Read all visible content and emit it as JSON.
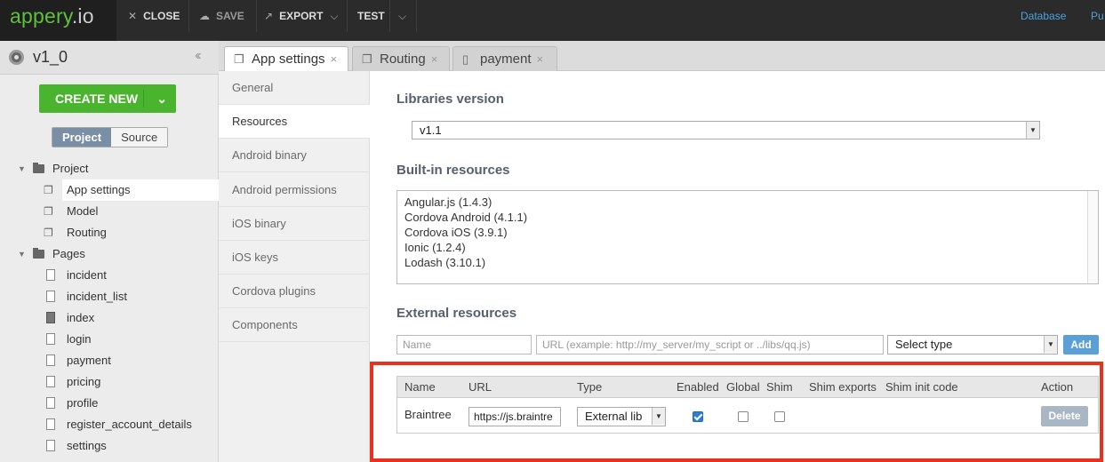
{
  "topbar": {
    "logo_main": "appery",
    "logo_ext": ".io",
    "close_label": "CLOSE",
    "save_label": "SAVE",
    "export_label": "EXPORT",
    "test_label": "TEST",
    "link_database": "Database",
    "link_truncated": "Pu"
  },
  "sidebar": {
    "project_name": "v1_0",
    "create_new_label": "CREATE NEW",
    "toggle": [
      "Project",
      "Source"
    ],
    "tree": [
      {
        "label": "Project",
        "kind": "folder"
      },
      {
        "label": "App settings",
        "kind": "config",
        "selected": true
      },
      {
        "label": "Model",
        "kind": "config"
      },
      {
        "label": "Routing",
        "kind": "config"
      },
      {
        "label": "Pages",
        "kind": "folder"
      },
      {
        "label": "incident",
        "kind": "page"
      },
      {
        "label": "incident_list",
        "kind": "page"
      },
      {
        "label": "index",
        "kind": "page-filled"
      },
      {
        "label": "login",
        "kind": "page"
      },
      {
        "label": "payment",
        "kind": "page"
      },
      {
        "label": "pricing",
        "kind": "page"
      },
      {
        "label": "profile",
        "kind": "page"
      },
      {
        "label": "register_account_details",
        "kind": "page"
      },
      {
        "label": "settings",
        "kind": "page"
      }
    ]
  },
  "tabs": [
    {
      "label": "App settings",
      "close": "×",
      "active": true
    },
    {
      "label": "Routing",
      "close": "×",
      "active": false
    },
    {
      "label": "payment",
      "close": "×",
      "active": false
    }
  ],
  "subnav": [
    "General",
    "Resources",
    "Android binary",
    "Android permissions",
    "iOS binary",
    "iOS keys",
    "Cordova plugins",
    "Components"
  ],
  "libraries": {
    "heading": "Libraries version",
    "selected": "v1.1"
  },
  "builtin": {
    "heading": "Built-in resources",
    "items": [
      "Angular.js (1.4.3)",
      "Cordova Android (4.1.1)",
      "Cordova iOS (3.9.1)",
      "Ionic (1.2.4)",
      "Lodash (3.10.1)"
    ]
  },
  "external": {
    "heading": "External resources",
    "name_placeholder": "Name",
    "url_placeholder": "URL (example: http://my_server/my_script or ../libs/qq.js)",
    "type_selected": "Select type",
    "add_label": "Add",
    "columns": [
      "Name",
      "URL",
      "Type",
      "Enabled",
      "Global",
      "Shim",
      "Shim exports",
      "Shim init code",
      "Action"
    ],
    "rows": [
      {
        "name": "Braintree",
        "url": "https://js.braintre",
        "type": "External lib",
        "enabled": true,
        "global": false,
        "shim": false,
        "action": "Delete"
      }
    ]
  },
  "colors": {
    "accent_green": "#4ab42e",
    "link_blue": "#4aa3df",
    "highlight_red": "#e8321e"
  }
}
